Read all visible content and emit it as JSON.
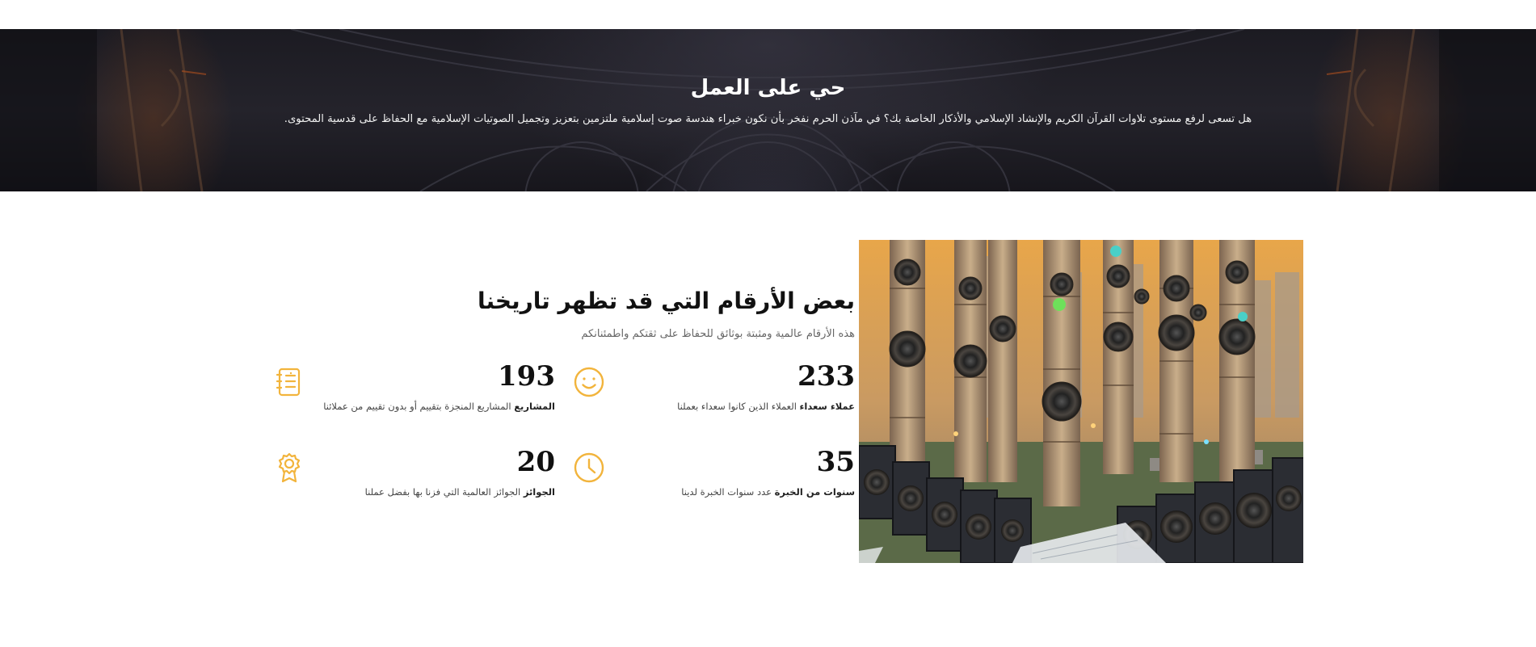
{
  "cta": {
    "title": "حي على العمل",
    "text": "هل تسعى لرفع مستوى تلاوات القرآن الكريم والإنشاد الإسلامي والأذكار الخاصة بك؟ في مآذن الحرم نفخر بأن نكون خبراء هندسة صوت إسلامية ملتزمين بتعزيز وتجميل الصوتيات الإسلامية مع الحفاظ على قدسية المحتوى."
  },
  "stats": {
    "title": "بعض الأرقام التي قد تظهر تاريخنا",
    "subtitle": "هذه الأرقام عالمية ومثبتة بوثائق للحفاظ على ثقتكم واطمئنانكم",
    "items": [
      {
        "number": "233",
        "label": "عملاء سعداء",
        "text": "العملاء الذين كانوا سعداء بعملنا",
        "icon": "smiley-icon"
      },
      {
        "number": "193",
        "label": "المشاريع",
        "text": "المشاريع المنجزة بتقييم أو بدون تقييم من عملائنا",
        "icon": "clipboard-list-icon"
      },
      {
        "number": "35",
        "label": "سنوات من الخبرة",
        "text": "عدد سنوات الخبرة لدينا",
        "icon": "clock-icon"
      },
      {
        "number": "20",
        "label": "الجوائز",
        "text": "الجوائز العالمية التي فزنا بها بفضل عملنا",
        "icon": "award-badge-icon"
      }
    ]
  },
  "colors": {
    "accent": "#f2b43c",
    "cta_background": "#1e1d24",
    "heading": "#111111"
  }
}
